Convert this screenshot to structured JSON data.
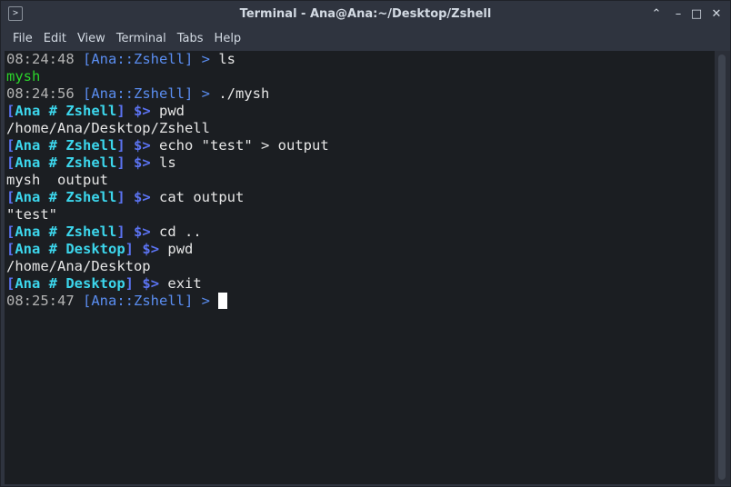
{
  "window": {
    "title": "Terminal - Ana@Ana:~/Desktop/Zshell",
    "app_icon": ">",
    "controls": {
      "keep_above": "⌃",
      "minimize": "–",
      "maximize": "□",
      "close": "✕"
    }
  },
  "menu": {
    "items": [
      "File",
      "Edit",
      "View",
      "Terminal",
      "Tabs",
      "Help"
    ]
  },
  "terminal": {
    "lines": [
      {
        "time": "08:24:48",
        "prompt": "[Ana::Zshell] >",
        "cmd": " ls"
      },
      {
        "output": "mysh"
      },
      {
        "time": "08:24:56",
        "prompt": "[Ana::Zshell] >",
        "cmd": " ./mysh"
      },
      {
        "p_open": "[",
        "p_user": "Ana # Zshell",
        "p_close": "]",
        "p_sym": "$>",
        "cmd": " pwd"
      },
      {
        "output": "/home/Ana/Desktop/Zshell"
      },
      {
        "p_open": "[",
        "p_user": "Ana # Zshell",
        "p_close": "]",
        "p_sym": "$>",
        "cmd": " echo \"test\" > output"
      },
      {
        "p_open": "[",
        "p_user": "Ana # Zshell",
        "p_close": "]",
        "p_sym": "$>",
        "cmd": " ls"
      },
      {
        "output": "mysh  output"
      },
      {
        "p_open": "[",
        "p_user": "Ana # Zshell",
        "p_close": "]",
        "p_sym": "$>",
        "cmd": " cat output"
      },
      {
        "output": "\"test\""
      },
      {
        "p_open": "[",
        "p_user": "Ana # Zshell",
        "p_close": "]",
        "p_sym": "$>",
        "cmd": " cd .."
      },
      {
        "p_open": "[",
        "p_user": "Ana # Desktop",
        "p_close": "]",
        "p_sym": "$>",
        "cmd": " pwd"
      },
      {
        "output": "/home/Ana/Desktop"
      },
      {
        "p_open": "[",
        "p_user": "Ana # Desktop",
        "p_close": "]",
        "p_sym": "$>",
        "cmd": " exit"
      },
      {
        "time": "08:25:47",
        "prompt": "[Ana::Zshell] >",
        "cmd": " "
      }
    ]
  },
  "colors": {
    "background": "#1b1e22",
    "chrome": "#2f343f",
    "timestamp": "#b3b3b3",
    "zsh_prompt": "#5a8df0",
    "mysh_user": "#3cd6ec",
    "mysh_symbol": "#5b73f2",
    "executable": "#2bd42b"
  }
}
